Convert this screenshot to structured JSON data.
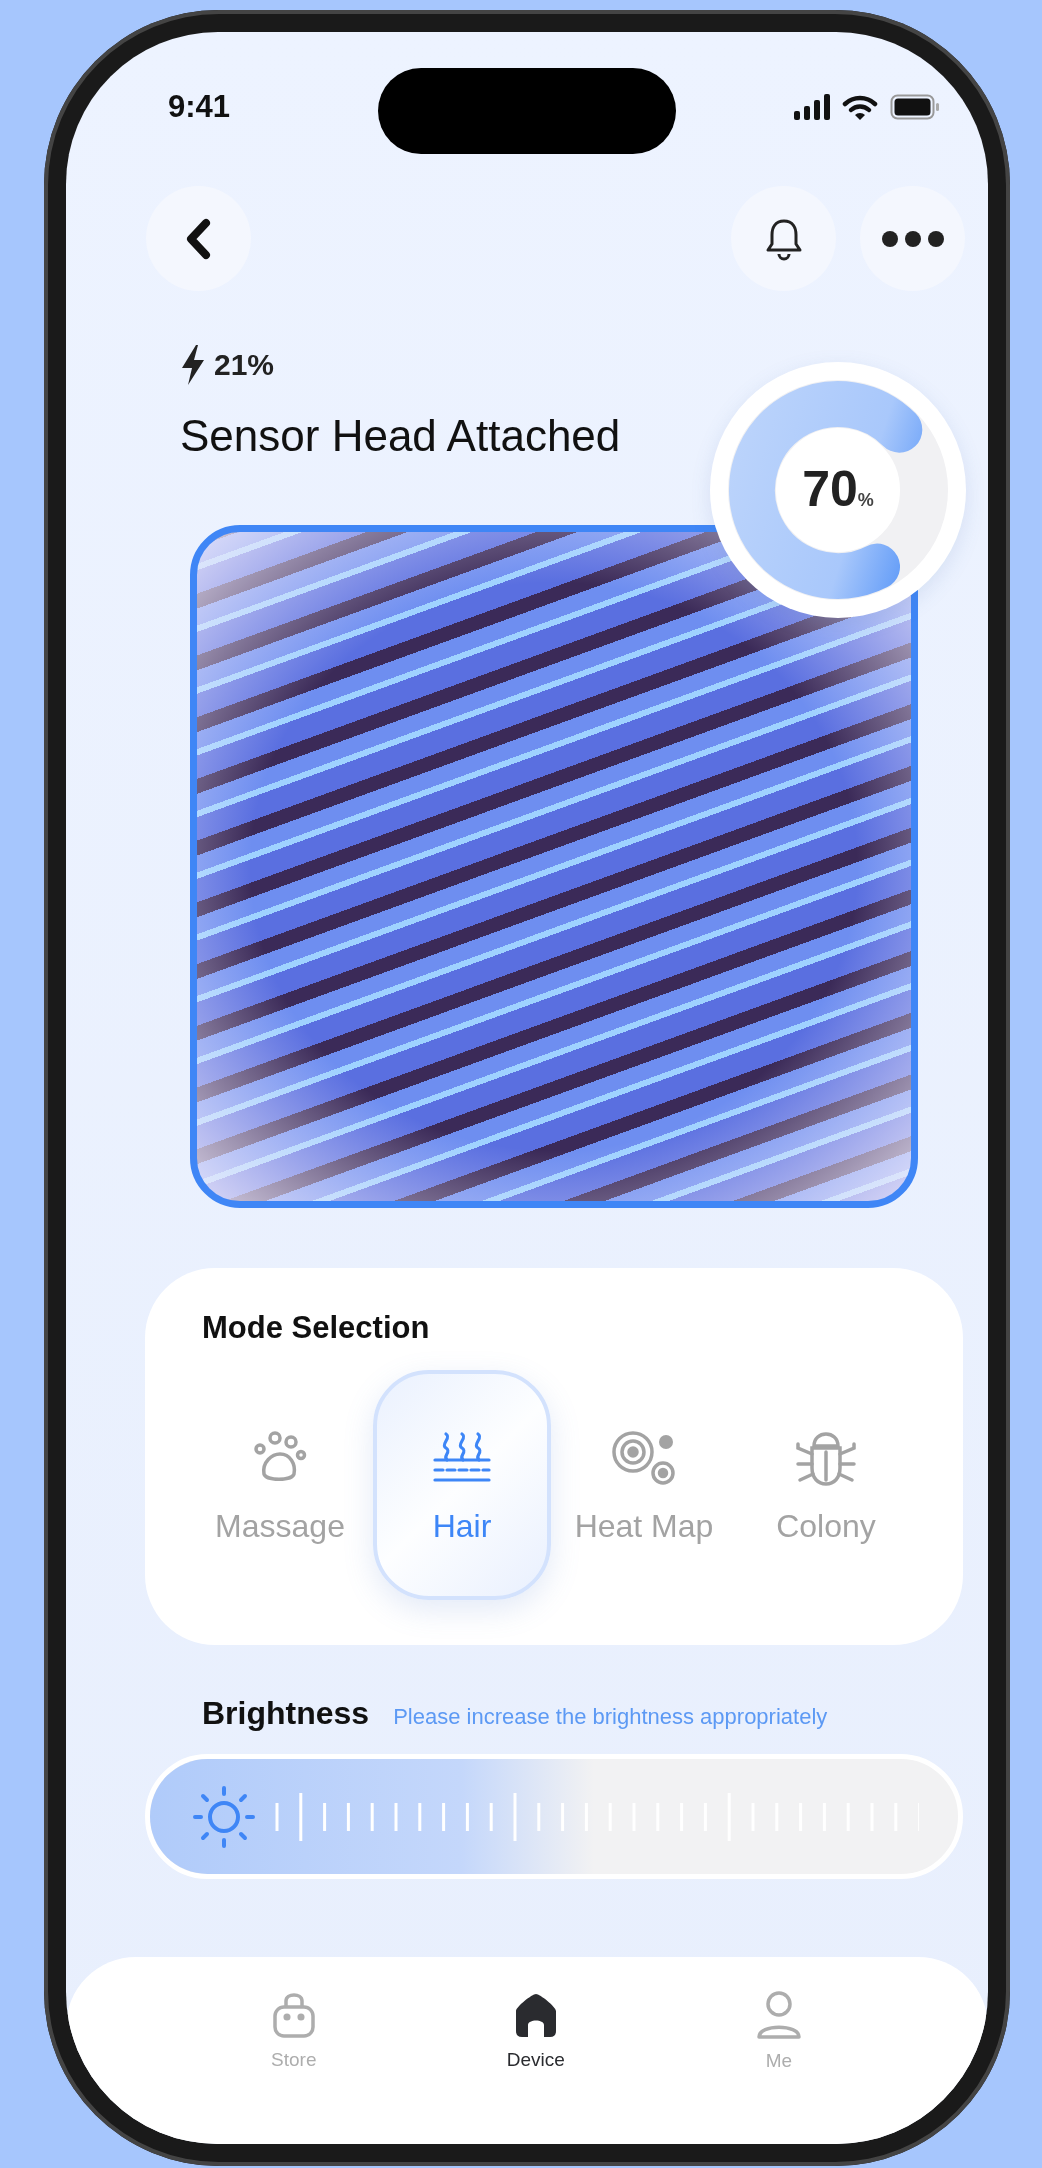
{
  "status_bar": {
    "time": "9:41"
  },
  "header": {
    "battery": "21%",
    "title": "Sensor Head Attached"
  },
  "gauge": {
    "value": "70",
    "unit": "%",
    "level": 0.7
  },
  "mode_selection": {
    "title": "Mode Selection",
    "modes": [
      {
        "label": "Massage",
        "kind": "paw",
        "selected": false
      },
      {
        "label": "Hair",
        "kind": "hair",
        "selected": true
      },
      {
        "label": "Heat Map",
        "kind": "heatmap",
        "selected": false
      },
      {
        "label": "Colony",
        "kind": "bug",
        "selected": false
      }
    ]
  },
  "brightness": {
    "label": "Brightness",
    "hint": "Please increase the brightness appropriately",
    "level": 0.55
  },
  "tab_bar": [
    {
      "label": "Store",
      "kind": "store",
      "selected": false
    },
    {
      "label": "Device",
      "kind": "device",
      "selected": true
    },
    {
      "label": "Me",
      "kind": "me",
      "selected": false
    }
  ]
}
